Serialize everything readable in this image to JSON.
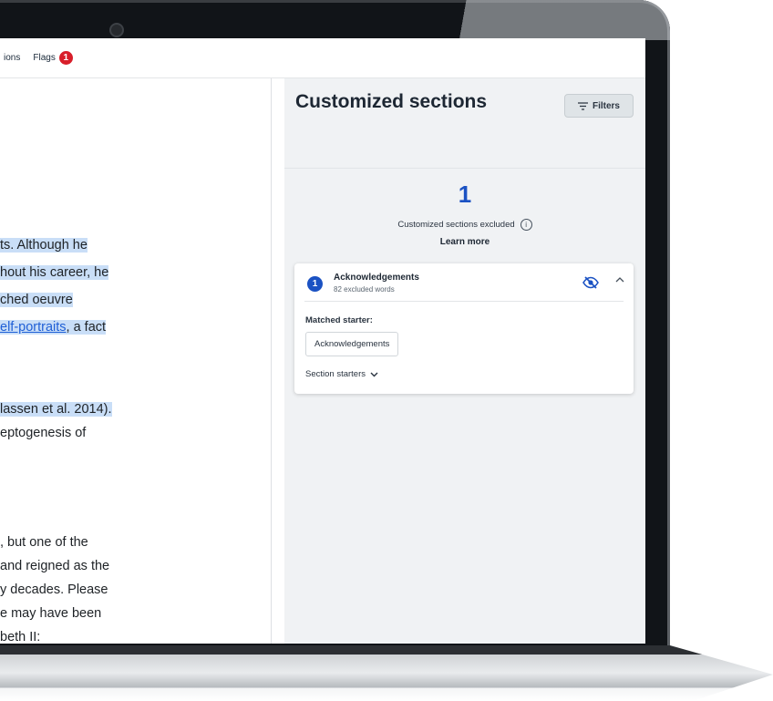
{
  "tabs": {
    "partial_tab_label": "ions",
    "flags_label": "Flags",
    "flags_count": "1"
  },
  "document": {
    "lines": [
      {
        "pre": "ts. Although he",
        "link": "",
        "post": "",
        "highlight": true
      },
      {
        "pre": "hout his career, he",
        "link": "",
        "post": "",
        "highlight": true
      },
      {
        "pre": "ched oeuvre",
        "link": "",
        "post": "",
        "highlight": true
      },
      {
        "pre": "",
        "link": "elf-portraits",
        "post": ", a fact",
        "highlight": true
      },
      {
        "pre": "lassen et al. 2014).",
        "link": "",
        "post": "",
        "highlight": true
      },
      {
        "pre": "eptogenesis of",
        "link": "",
        "post": "",
        "highlight": false
      },
      {
        "pre": ", but one of the",
        "link": "",
        "post": "",
        "highlight": false
      },
      {
        "pre": "and reigned as the",
        "link": "",
        "post": "",
        "highlight": false
      },
      {
        "pre": "y decades. Please",
        "link": "",
        "post": "",
        "highlight": false
      },
      {
        "pre": "e may have been",
        "link": "",
        "post": "",
        "highlight": false
      },
      {
        "pre": "beth II:",
        "link": "",
        "post": "",
        "highlight": false
      }
    ]
  },
  "panel": {
    "title": "Customized sections",
    "filters_label": "Filters",
    "excluded_count": "1",
    "excluded_label": "Customized sections excluded",
    "learn_more": "Learn more",
    "card": {
      "number": "1",
      "title": "Acknowledgements",
      "subtitle": "82 excluded words",
      "matched_label": "Matched starter:",
      "chip_text": "Acknowledgements",
      "section_starters_label": "Section starters"
    }
  },
  "colors": {
    "accent_blue": "#1b52c3",
    "flag_red": "#d81e2a",
    "highlight": "#c9def7",
    "link": "#1f5fd6"
  }
}
